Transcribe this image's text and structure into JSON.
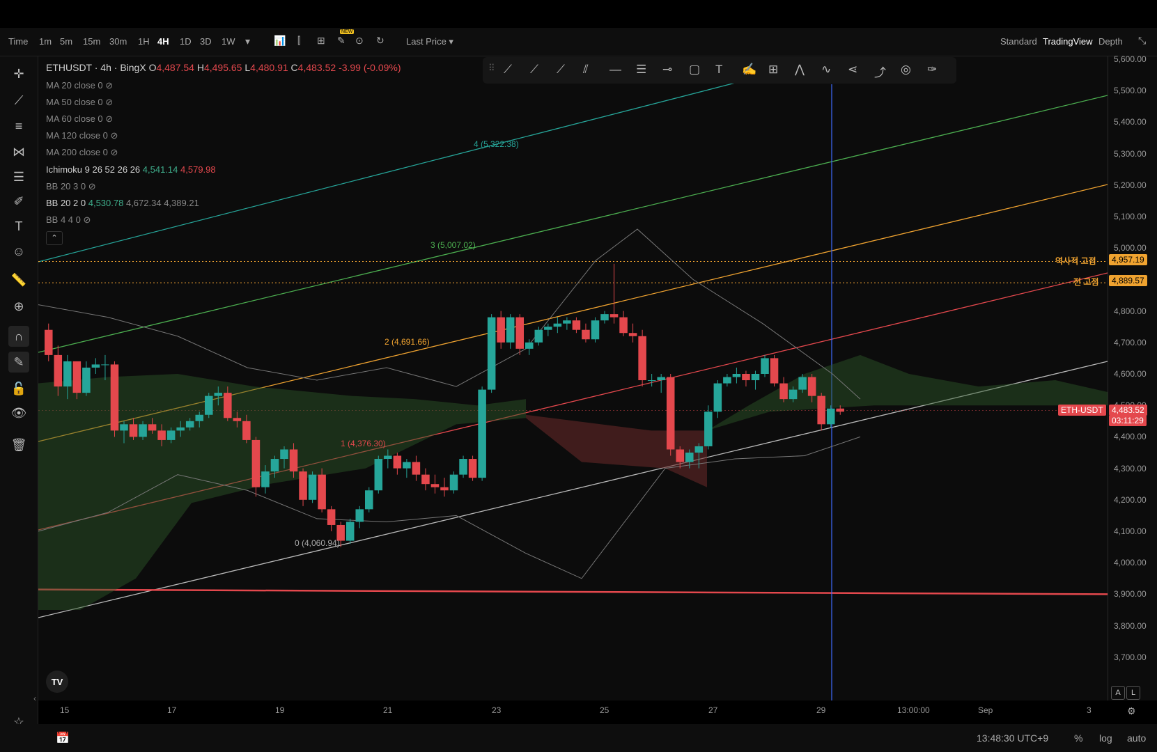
{
  "toolbar": {
    "timeframes": [
      "Time",
      "1m",
      "5m",
      "15m",
      "30m",
      "1H",
      "4H",
      "1D",
      "3D",
      "1W"
    ],
    "active_timeframe": "4H",
    "price_source": "Last Price",
    "new_badge": "NEW",
    "view_modes": [
      "Standard",
      "TradingView",
      "Depth"
    ],
    "active_view_mode": "TradingView"
  },
  "legend": {
    "symbol": "ETHUSDT · 4h · BingX",
    "o_label": "O",
    "o": "4,487.54",
    "h_label": "H",
    "h": "4,495.65",
    "l_label": "L",
    "l": "4,480.91",
    "c_label": "C",
    "c": "4,483.52",
    "change": "-3.99 (-0.09%)",
    "indicators": [
      {
        "label": "MA 20 close 0",
        "values": ""
      },
      {
        "label": "MA 50 close 0",
        "values": ""
      },
      {
        "label": "MA 60 close 0",
        "values": ""
      },
      {
        "label": "MA 120 close 0",
        "values": ""
      },
      {
        "label": "MA 200 close 0",
        "values": ""
      }
    ],
    "ichimoku_label": "Ichimoku 9 26 52 26 26",
    "ichimoku_v1": "4,541.14",
    "ichimoku_v2": "4,579.98",
    "bb1_label": "BB 20 3 0",
    "bb2_label": "BB 20 2 0",
    "bb2_v1": "4,530.78",
    "bb2_v2": "4,672.34",
    "bb2_v3": "4,389.21",
    "bb3_label": "BB 4 4 0"
  },
  "chart_data": {
    "type": "candlestick",
    "symbol": "ETHUSDT",
    "interval": "4h",
    "x_ticks": [
      "15",
      "17",
      "19",
      "21",
      "23",
      "25",
      "27",
      "29",
      "13:00:00",
      "Sep",
      "3"
    ],
    "y_ticks": [
      "5,600.00",
      "5,500.00",
      "5,400.00",
      "5,300.00",
      "5,200.00",
      "5,100.00",
      "5,000.00",
      "4,900.00",
      "4,800.00",
      "4,700.00",
      "4,600.00",
      "4,500.00",
      "4,400.00",
      "4,300.00",
      "4,200.00",
      "4,100.00",
      "4,000.00",
      "3,900.00",
      "3,800.00",
      "3,700.00"
    ],
    "ylim": [
      3650,
      5600
    ],
    "fib_labels": [
      "4 (5,322.38)",
      "3 (5,007.02)",
      "2 (4,691.66)",
      "1 (4,376.30)",
      "0 (4,060.94)"
    ],
    "hlines": [
      {
        "label": "역사적 고점",
        "value": "4,957.19"
      },
      {
        "label": "전 고점",
        "value": "4,889.57"
      }
    ],
    "last_price_tag": "ETH-USDT",
    "last_price": "4,483.52",
    "countdown": "03:11:29",
    "candles": [
      [
        4740,
        4760,
        4640,
        4660
      ],
      [
        4660,
        4690,
        4530,
        4560
      ],
      [
        4560,
        4660,
        4520,
        4640
      ],
      [
        4640,
        4640,
        4520,
        4540
      ],
      [
        4540,
        4640,
        4530,
        4620
      ],
      [
        4620,
        4650,
        4600,
        4630
      ],
      [
        4630,
        4660,
        4580,
        4630
      ],
      [
        4630,
        4640,
        4400,
        4420
      ],
      [
        4420,
        4450,
        4380,
        4440
      ],
      [
        4440,
        4460,
        4390,
        4400
      ],
      [
        4400,
        4450,
        4390,
        4440
      ],
      [
        4440,
        4460,
        4410,
        4420
      ],
      [
        4420,
        4440,
        4370,
        4390
      ],
      [
        4390,
        4430,
        4380,
        4420
      ],
      [
        4420,
        4450,
        4400,
        4430
      ],
      [
        4430,
        4460,
        4420,
        4450
      ],
      [
        4450,
        4480,
        4430,
        4470
      ],
      [
        4470,
        4540,
        4460,
        4530
      ],
      [
        4530,
        4560,
        4500,
        4540
      ],
      [
        4540,
        4560,
        4450,
        4460
      ],
      [
        4460,
        4480,
        4430,
        4450
      ],
      [
        4450,
        4470,
        4380,
        4390
      ],
      [
        4390,
        4400,
        4210,
        4240
      ],
      [
        4240,
        4310,
        4220,
        4290
      ],
      [
        4290,
        4340,
        4270,
        4330
      ],
      [
        4330,
        4370,
        4300,
        4360
      ],
      [
        4360,
        4380,
        4270,
        4290
      ],
      [
        4290,
        4300,
        4180,
        4200
      ],
      [
        4200,
        4290,
        4190,
        4280
      ],
      [
        4280,
        4300,
        4160,
        4170
      ],
      [
        4170,
        4180,
        4100,
        4120
      ],
      [
        4120,
        4130,
        4050,
        4070
      ],
      [
        4070,
        4140,
        4060,
        4130
      ],
      [
        4130,
        4180,
        4110,
        4170
      ],
      [
        4170,
        4240,
        4160,
        4230
      ],
      [
        4230,
        4340,
        4220,
        4330
      ],
      [
        4330,
        4360,
        4300,
        4340
      ],
      [
        4340,
        4350,
        4280,
        4300
      ],
      [
        4300,
        4330,
        4270,
        4320
      ],
      [
        4320,
        4340,
        4260,
        4280
      ],
      [
        4280,
        4300,
        4230,
        4250
      ],
      [
        4250,
        4280,
        4220,
        4240
      ],
      [
        4240,
        4270,
        4210,
        4230
      ],
      [
        4230,
        4290,
        4220,
        4280
      ],
      [
        4280,
        4340,
        4270,
        4330
      ],
      [
        4330,
        4340,
        4260,
        4270
      ],
      [
        4270,
        4560,
        4260,
        4550
      ],
      [
        4550,
        4790,
        4540,
        4780
      ],
      [
        4780,
        4800,
        4680,
        4700
      ],
      [
        4700,
        4790,
        4680,
        4780
      ],
      [
        4780,
        4790,
        4660,
        4680
      ],
      [
        4680,
        4710,
        4660,
        4700
      ],
      [
        4700,
        4750,
        4690,
        4740
      ],
      [
        4740,
        4760,
        4720,
        4750
      ],
      [
        4750,
        4780,
        4730,
        4760
      ],
      [
        4760,
        4780,
        4740,
        4770
      ],
      [
        4770,
        4780,
        4730,
        4740
      ],
      [
        4740,
        4760,
        4700,
        4710
      ],
      [
        4710,
        4780,
        4700,
        4770
      ],
      [
        4770,
        4800,
        4760,
        4790
      ],
      [
        4790,
        4950,
        4760,
        4780
      ],
      [
        4780,
        4800,
        4720,
        4730
      ],
      [
        4730,
        4760,
        4700,
        4720
      ],
      [
        4720,
        4740,
        4560,
        4580
      ],
      [
        4580,
        4600,
        4560,
        4580
      ],
      [
        4580,
        4600,
        4540,
        4590
      ],
      [
        4590,
        4600,
        4340,
        4360
      ],
      [
        4360,
        4370,
        4300,
        4320
      ],
      [
        4320,
        4360,
        4300,
        4350
      ],
      [
        4350,
        4380,
        4300,
        4370
      ],
      [
        4370,
        4500,
        4360,
        4480
      ],
      [
        4480,
        4580,
        4460,
        4570
      ],
      [
        4570,
        4600,
        4560,
        4590
      ],
      [
        4590,
        4620,
        4570,
        4600
      ],
      [
        4600,
        4610,
        4560,
        4580
      ],
      [
        4580,
        4610,
        4550,
        4600
      ],
      [
        4600,
        4660,
        4590,
        4650
      ],
      [
        4650,
        4660,
        4560,
        4570
      ],
      [
        4570,
        4590,
        4510,
        4520
      ],
      [
        4520,
        4560,
        4510,
        4550
      ],
      [
        4550,
        4600,
        4540,
        4590
      ],
      [
        4590,
        4600,
        4510,
        4530
      ],
      [
        4530,
        4540,
        4420,
        4440
      ],
      [
        4440,
        4500,
        4430,
        4490
      ],
      [
        4490,
        4500,
        4470,
        4480
      ]
    ]
  }
}
